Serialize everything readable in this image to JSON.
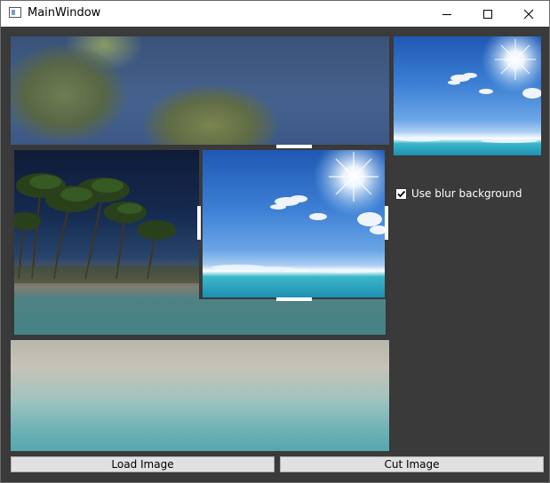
{
  "window": {
    "title": "MainWindow"
  },
  "options": {
    "blur_background_label": "Use blur background",
    "blur_background_checked": true
  },
  "buttons": {
    "load_label": "Load Image",
    "cut_label": "Cut Image"
  },
  "icons": {
    "app": "app-window-icon",
    "minimize": "minimize-icon",
    "maximize": "maximize-icon",
    "close": "close-icon"
  }
}
